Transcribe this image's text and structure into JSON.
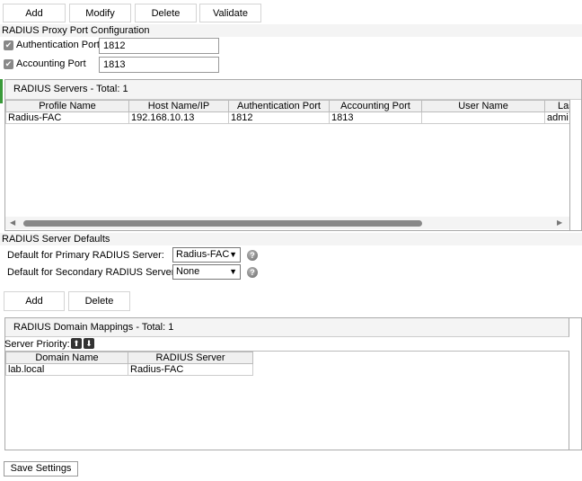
{
  "toolbar": {
    "add": "Add",
    "modify": "Modify",
    "delete": "Delete",
    "validate": "Validate"
  },
  "proxy": {
    "title": "RADIUS Proxy Port Configuration",
    "auth_label": "Authentication Port",
    "auth_value": "1812",
    "acct_label": "Accounting Port",
    "acct_value": "1813"
  },
  "servers": {
    "title": "RADIUS Servers - Total: 1",
    "columns": [
      "Profile Name",
      "Host Name/IP",
      "Authentication Port",
      "Accounting Port",
      "User Name",
      "Las"
    ],
    "rows": [
      [
        "Radius-FAC",
        "192.168.10.13",
        "1812",
        "1813",
        "",
        "admi"
      ]
    ]
  },
  "defaults": {
    "title": "RADIUS Server Defaults",
    "primary_label": "Default for Primary RADIUS Server:",
    "primary_value": "Radius-FAC",
    "secondary_label": "Default for Secondary RADIUS Server:",
    "secondary_value": "None"
  },
  "mapping_toolbar": {
    "add": "Add",
    "delete": "Delete"
  },
  "mappings": {
    "title": "RADIUS Domain Mappings - Total: 1",
    "priority_label": "Server Priority:",
    "columns": [
      "Domain Name",
      "RADIUS Server"
    ],
    "rows": [
      [
        "lab.local",
        "Radius-FAC"
      ]
    ]
  },
  "save": "Save Settings"
}
